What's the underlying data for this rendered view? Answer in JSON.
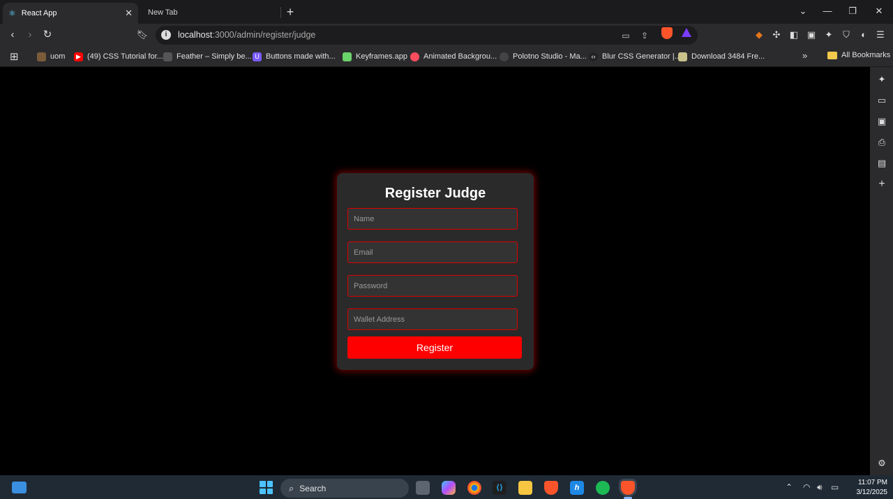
{
  "browser": {
    "tabs": [
      {
        "title": "React App",
        "active": true
      },
      {
        "title": "New Tab",
        "active": false
      }
    ],
    "url_host": "localhost",
    "url_rest": ":3000/admin/register/judge",
    "bookmarks": [
      {
        "label": "uom",
        "icon": "uom-icon",
        "color": "#7a5c3a"
      },
      {
        "label": "(49) CSS Tutorial for...",
        "icon": "youtube-icon",
        "color": "#ff0000"
      },
      {
        "label": "Feather – Simply be...",
        "icon": "feather-icon",
        "color": "#555555"
      },
      {
        "label": "Buttons made with...",
        "icon": "uiverse-icon",
        "color": "#7b5cff"
      },
      {
        "label": "Keyframes.app",
        "icon": "keyframes-icon",
        "color": "#6ad36a"
      },
      {
        "label": "Animated Backgrou...",
        "icon": "animated-bg-icon",
        "color": "#ff4d5e"
      },
      {
        "label": "Polotno Studio - Ma...",
        "icon": "polotno-icon",
        "color": "#444444"
      },
      {
        "label": "Blur CSS Generator |...",
        "icon": "code-icon",
        "color": "#222222"
      },
      {
        "label": "Download 3484 Fre...",
        "icon": "download-icon",
        "color": "#c9c28a"
      }
    ],
    "all_bookmarks": "All Bookmarks"
  },
  "form": {
    "title": "Register Judge",
    "name_placeholder": "Name",
    "email_placeholder": "Email",
    "password_placeholder": "Password",
    "wallet_placeholder": "Wallet Address",
    "submit_label": "Register",
    "accent": "#ff0000"
  },
  "taskbar": {
    "search_label": "Search",
    "time": "11:07 PM",
    "date": "3/12/2025"
  }
}
